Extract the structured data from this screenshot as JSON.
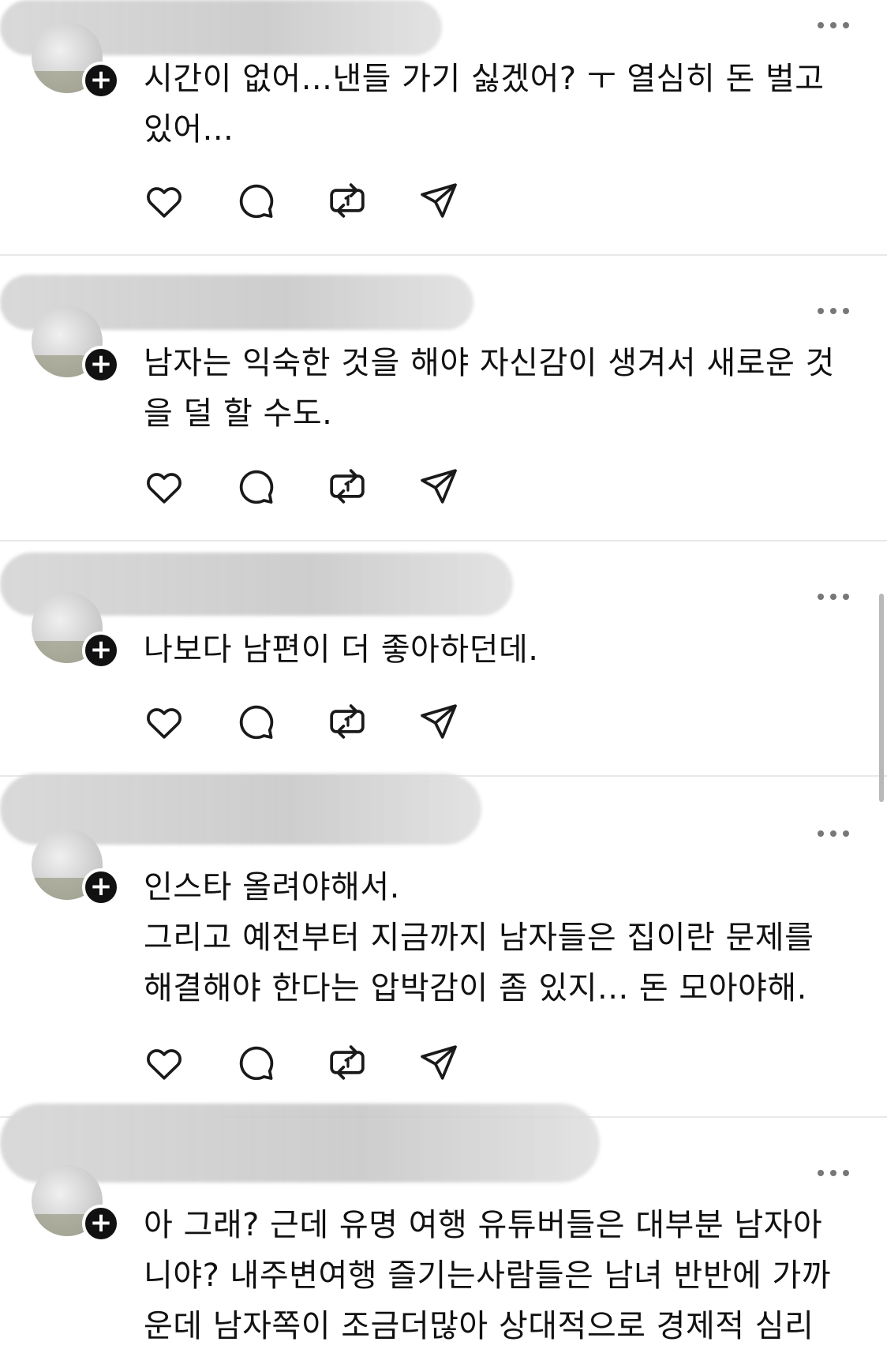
{
  "icons": {
    "follow": "plus-icon",
    "more": "more-horizontal-icon",
    "like": "heart-icon",
    "reply": "comment-icon",
    "repost": "repost-icon",
    "share": "send-icon"
  },
  "colors": {
    "text": "#111111",
    "icon": "#1a1a1a",
    "divider": "#e8e8e8",
    "redaction": "#d2d2d2"
  },
  "follow_glyph": "+",
  "posts": [
    {
      "text": "시간이 없어...낸들 가기 싫겠어? ㅜ 열심히 돈 벌고\n있어..."
    },
    {
      "text": "남자는 익숙한 것을 해야 자신감이 생겨서 새로운 것\n을 덜 할 수도."
    },
    {
      "text": "나보다 남편이 더 좋아하던데."
    },
    {
      "text": "인스타 올려야해서.\n그리고 예전부터 지금까지 남자들은 집이란 문제를\n해결해야 한다는 압박감이 좀 있지... 돈 모아야해."
    },
    {
      "text": "아 그래? 근데 유명 여행 유튜버들은 대부분 남자아\n니야? 내주변여행 즐기는사람들은 남녀 반반에 가까\n운데 남자쪽이 조금더많아 상대적으로 경제적 심리"
    }
  ]
}
